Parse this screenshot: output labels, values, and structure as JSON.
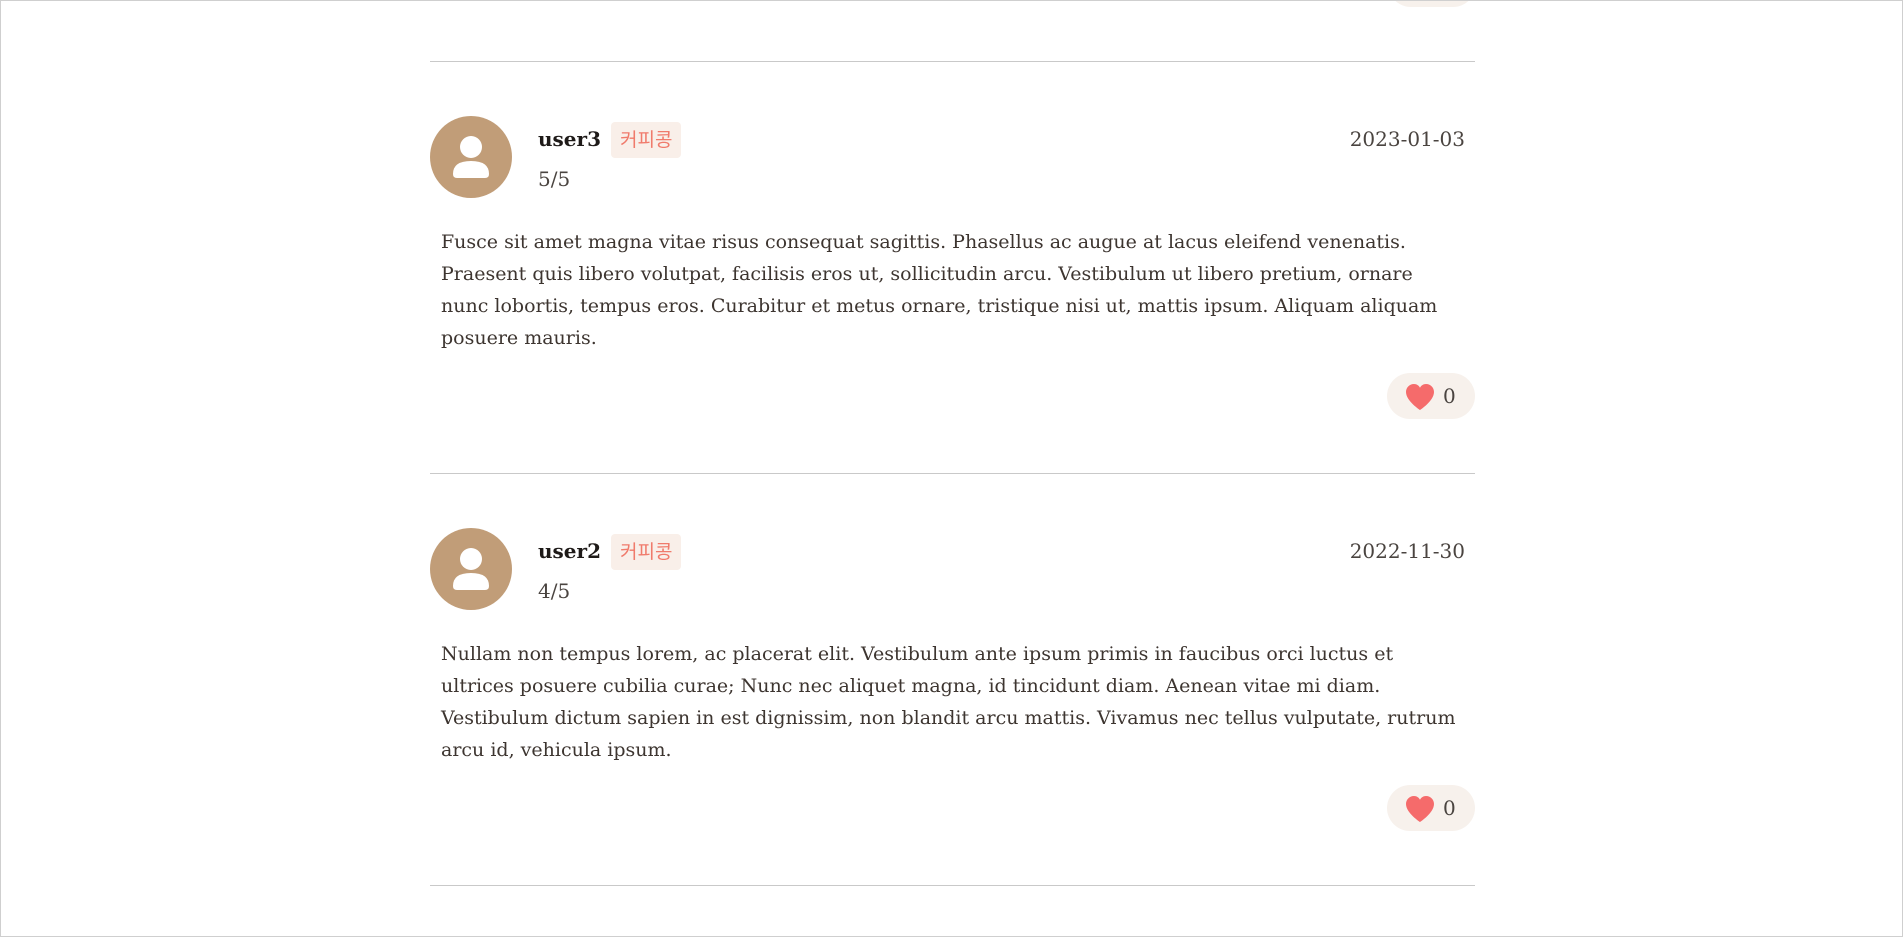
{
  "colors": {
    "avatar_bg": "#c19d78",
    "tag_text": "#f07b6c",
    "tag_bg": "#f9efe9",
    "heart": "#f56b6b",
    "pill_bg": "#f7f1ec",
    "divider": "#c9c9c9"
  },
  "icons": {
    "avatar": "user-silhouette-icon",
    "like": "heart-icon"
  },
  "reviews": [
    {
      "username": "user3",
      "tag": "커피콩",
      "rating": "5/5",
      "date": "2023-01-03",
      "body": "Fusce sit amet magna vitae risus consequat sagittis. Phasellus ac augue at lacus eleifend venenatis. Praesent quis libero volutpat, facilisis eros ut, sollicitudin arcu. Vestibulum ut libero pretium, ornare nunc lobortis, tempus eros. Curabitur et metus ornare, tristique nisi ut, mattis ipsum. Aliquam aliquam posuere mauris.",
      "likes": "0"
    },
    {
      "username": "user2",
      "tag": "커피콩",
      "rating": "4/5",
      "date": "2022-11-30",
      "body": "Nullam non tempus lorem, ac placerat elit. Vestibulum ante ipsum primis in faucibus orci luctus et ultrices posuere cubilia curae; Nunc nec aliquet magna, id tincidunt diam. Aenean vitae mi diam. Vestibulum dictum sapien in est dignissim, non blandit arcu mattis. Vivamus nec tellus vulputate, rutrum arcu id, vehicula ipsum.",
      "likes": "0"
    }
  ]
}
